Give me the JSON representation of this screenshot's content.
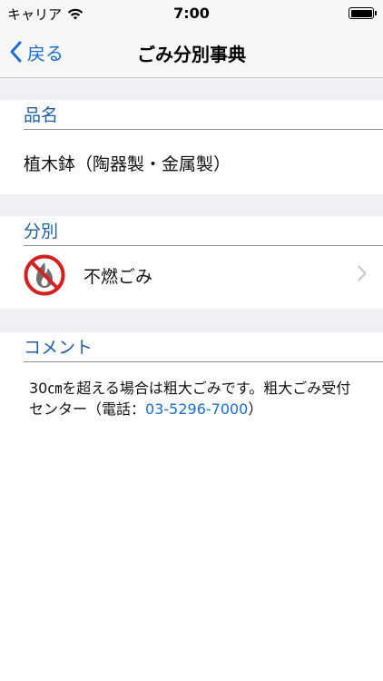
{
  "status_bar": {
    "carrier": "キャリア",
    "time": "7:00"
  },
  "nav": {
    "back_label": "戻る",
    "title": "ごみ分別事典"
  },
  "sections": {
    "name": {
      "header": "品名",
      "value": "植木鉢（陶器製・金属製）"
    },
    "category": {
      "header": "分別",
      "value": "不燃ごみ",
      "icon": "no-fire-icon"
    },
    "comment": {
      "header": "コメント",
      "text_before": "30㎝を超える場合は粗大ごみです。粗大ごみ受付センター（電話：",
      "phone": "03-5296-7000",
      "text_after": "）"
    }
  },
  "colors": {
    "accent": "#1a6fd0",
    "section_header": "#1f5f9a",
    "background_gap": "#efeff4"
  }
}
